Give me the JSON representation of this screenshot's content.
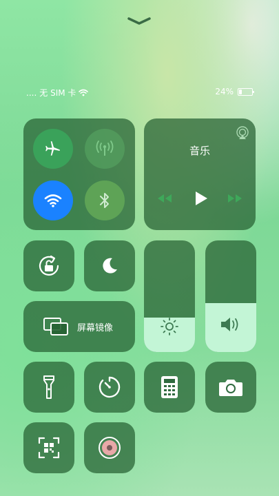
{
  "status": {
    "signal": "....",
    "carrier": "无 SIM 卡",
    "battery": "24%",
    "battery_level": 0.24
  },
  "music": {
    "title": "音乐"
  },
  "screen_mirroring": {
    "label": "屏幕镜像"
  },
  "sliders": {
    "brightness_level": 0.31,
    "volume_level": 0.44
  },
  "colors": {
    "wifi_active": "#1a82ff",
    "airplane_active": "#3aa25a",
    "bluetooth": "#5ea356",
    "tile": "#266032"
  },
  "icons": [
    "chevron-down-icon",
    "airplane-icon",
    "cellular-antenna-icon",
    "wifi-icon",
    "bluetooth-icon",
    "airplay-icon",
    "rewind-icon",
    "play-icon",
    "fast-forward-icon",
    "rotation-lock-icon",
    "moon-icon",
    "screen-mirroring-icon",
    "brightness-icon",
    "volume-icon",
    "flashlight-icon",
    "timer-icon",
    "calculator-icon",
    "camera-icon",
    "qr-scanner-icon",
    "screen-record-icon"
  ]
}
